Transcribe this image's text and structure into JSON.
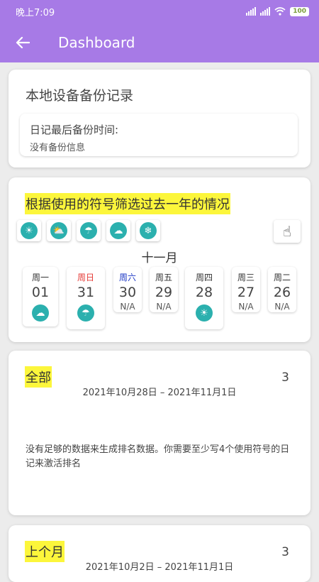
{
  "status": {
    "time": "晚上7:09",
    "battery": "100"
  },
  "appbar": {
    "title": "Dashboard"
  },
  "backup": {
    "title": "本地设备备份记录",
    "label": "日记最后备份时间:",
    "value": "没有备份信息"
  },
  "symbols": {
    "title": "根据使用的符号筛选过去一年的情况",
    "filter_icons": [
      "sun-icon",
      "partly-cloudy-icon",
      "cloud-rain-icon",
      "cloud-storm-icon",
      "snow-icon"
    ],
    "month": "十一月",
    "days": [
      {
        "name": "周一",
        "num": "01",
        "icon": "cloud-storm-icon",
        "color": "#333333"
      },
      {
        "name": "周日",
        "num": "31",
        "icon": "cloud-rain-icon",
        "color": "#e53935"
      },
      {
        "name": "周六",
        "num": "30",
        "na": "N/A",
        "color": "#1a36c4"
      },
      {
        "name": "周五",
        "num": "29",
        "na": "N/A",
        "color": "#333333"
      },
      {
        "name": "周四",
        "num": "28",
        "icon": "sun-icon",
        "color": "#333333"
      },
      {
        "name": "周三",
        "num": "27",
        "na": "N/A",
        "color": "#333333"
      },
      {
        "name": "周二",
        "num": "26",
        "na": "N/A",
        "color": "#333333"
      }
    ]
  },
  "ranking_all": {
    "title": "全部",
    "count": "3",
    "range": "2021年10月28日 – 2021年11月1日",
    "message": "没有足够的数据来生成排名数据。你需要至少写4个使用符号的日记来激活排名"
  },
  "ranking_last_month": {
    "title": "上个月",
    "count": "3",
    "range": "2021年10月2日 – 2021年11月1日"
  }
}
